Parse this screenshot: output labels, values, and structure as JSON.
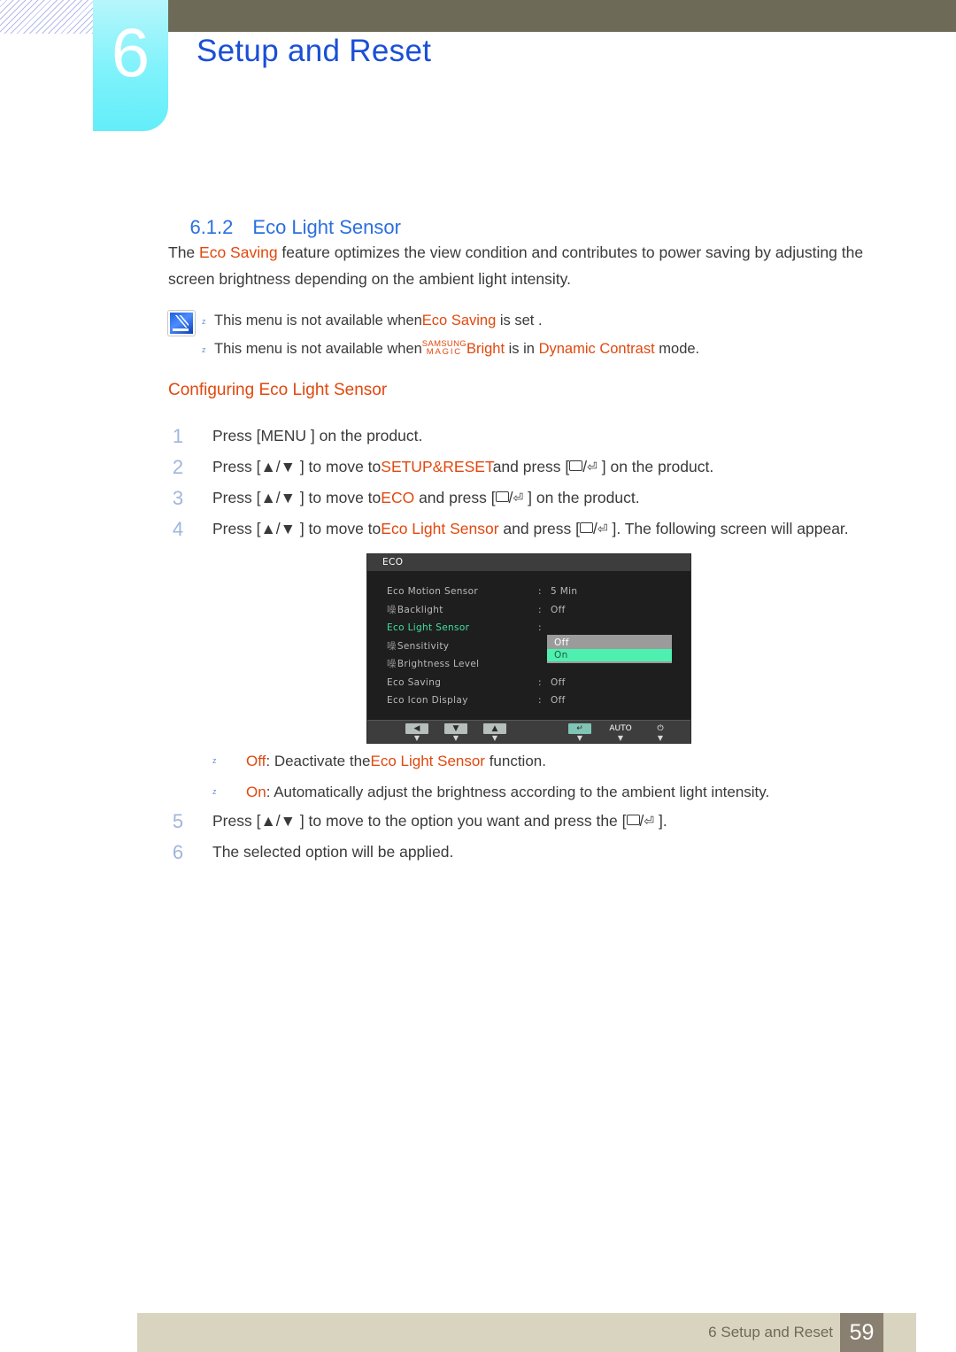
{
  "header": {
    "chapter_number": "6",
    "chapter_title": "Setup and Reset"
  },
  "section": {
    "number": "6.1.2",
    "title": "Eco Light Sensor"
  },
  "intro": {
    "part1": "The ",
    "highlight1": "Eco Saving",
    "part2": " feature optimizes the view condition and contributes to power saving by adjusting the screen brightness depending on the ambient light intensity."
  },
  "notes": {
    "icon": "note-pencil-icon",
    "items": [
      {
        "bullet": "z",
        "pre": "This menu is not available when",
        "highlight": "Eco Saving",
        "post": " is set ."
      },
      {
        "bullet": "z",
        "pre": "This menu is not available when",
        "magic_top": "SAMSUNG",
        "magic_bottom": "MAGIC",
        "magic_word": "Bright",
        "mid": " is in ",
        "highlight": "Dynamic Contrast",
        "post": "  mode."
      }
    ]
  },
  "configuring": {
    "heading": "Configuring Eco Light Sensor",
    "steps": [
      {
        "number": "1",
        "segments": [
          {
            "t": "Press [",
            "k": "plain"
          },
          {
            "t": "MENU",
            "k": "kbd"
          },
          {
            "t": " ] on the product.",
            "k": "plain"
          }
        ]
      },
      {
        "number": "2",
        "segments": [
          {
            "t": "Press [▲/▼ ] to move to",
            "k": "plain"
          },
          {
            "t": "SETUP&RESET",
            "k": "orange"
          },
          {
            "t": "and press [",
            "k": "plain"
          },
          {
            "t": "RECT",
            "k": "rect"
          },
          {
            "t": "/",
            "k": "plain"
          },
          {
            "t": "ENTER",
            "k": "enter"
          },
          {
            "t": " ] on the product.",
            "k": "plain"
          }
        ]
      },
      {
        "number": "3",
        "segments": [
          {
            "t": "Press [▲/▼ ] to move to",
            "k": "plain"
          },
          {
            "t": "ECO",
            "k": "orange"
          },
          {
            "t": " and press [",
            "k": "plain"
          },
          {
            "t": "RECT",
            "k": "rect"
          },
          {
            "t": "/",
            "k": "plain"
          },
          {
            "t": "ENTER",
            "k": "enter"
          },
          {
            "t": " ] on the product.",
            "k": "plain"
          }
        ]
      },
      {
        "number": "4",
        "segments": [
          {
            "t": "Press [▲/▼ ] to move to",
            "k": "plain"
          },
          {
            "t": "Eco Light Sensor",
            "k": "orange"
          },
          {
            "t": " and press [",
            "k": "plain"
          },
          {
            "t": "RECT",
            "k": "rect"
          },
          {
            "t": "/",
            "k": "plain"
          },
          {
            "t": "ENTER",
            "k": "enter"
          },
          {
            "t": " ]. The following screen will appear.",
            "k": "plain"
          }
        ]
      }
    ],
    "steps_after": [
      {
        "number": "5",
        "segments": [
          {
            "t": "Press [▲/▼ ] to move to the option you want and press the [",
            "k": "plain"
          },
          {
            "t": "RECT",
            "k": "rect"
          },
          {
            "t": "/",
            "k": "plain"
          },
          {
            "t": "ENTER",
            "k": "enter"
          },
          {
            "t": " ].",
            "k": "plain"
          }
        ]
      },
      {
        "number": "6",
        "segments": [
          {
            "t": "The selected option will be applied.",
            "k": "plain"
          }
        ]
      }
    ]
  },
  "osd": {
    "title": "ECO",
    "rows": [
      {
        "icon": "",
        "label": "Eco Motion Sensor",
        "colon": ":",
        "value": "5 Min",
        "selected": false
      },
      {
        "icon": "噪",
        "label": "Backlight",
        "colon": ":",
        "value": "Off",
        "selected": false
      },
      {
        "icon": "",
        "label": "Eco Light Sensor",
        "colon": ":",
        "value": "",
        "selected": true
      },
      {
        "icon": "噪",
        "label": "Sensitivity",
        "colon": "",
        "value": "",
        "selected": false
      },
      {
        "icon": "噪",
        "label": "Brightness Level",
        "colon": "",
        "value": "",
        "selected": false
      },
      {
        "icon": "",
        "label": "Eco Saving",
        "colon": ":",
        "value": "Off",
        "selected": false
      },
      {
        "icon": "",
        "label": "Eco Icon Display",
        "colon": ":",
        "value": "Off",
        "selected": false
      }
    ],
    "dropdown": {
      "options": [
        "Off",
        "On"
      ],
      "selected": "On"
    },
    "footer_buttons": [
      {
        "name": "left-button",
        "glyph": "◀",
        "style": "cap",
        "tick": "▼"
      },
      {
        "name": "down-button",
        "glyph": "▼",
        "style": "cap",
        "tick": "▼"
      },
      {
        "name": "up-button",
        "glyph": "▲",
        "style": "cap",
        "tick": "▼"
      },
      {
        "name": "enter-button",
        "glyph": "↵",
        "style": "cap-teal",
        "tick": "▼"
      },
      {
        "name": "auto-button",
        "glyph": "AUTO",
        "style": "text",
        "tick": "▼"
      },
      {
        "name": "power-button",
        "glyph": "⏻",
        "style": "text",
        "tick": "▼"
      }
    ],
    "colors": {
      "selected_label": "#3fe0a0",
      "dropdown_highlight": "#4ef0b0",
      "dropdown_bg": "#9b9b9b"
    }
  },
  "option_bullets": [
    {
      "bullet": "z",
      "name": "Off",
      "pre": ": Deactivate the",
      "highlight": "Eco Light Sensor",
      "post": "  function."
    },
    {
      "bullet": "z",
      "name": "On",
      "pre": ": Automatically adjust the brightness according to the ambient light intensity.",
      "highlight": "",
      "post": ""
    }
  ],
  "footer": {
    "text": "6 Setup and Reset",
    "page": "59"
  },
  "colors": {
    "accent_blue": "#2a6fe0",
    "accent_orange": "#e1480e",
    "olive": "#6d6b58",
    "cyan": "#7ef2fb",
    "footer_bg": "#d9d4bf",
    "page_box": "#8a8071"
  }
}
